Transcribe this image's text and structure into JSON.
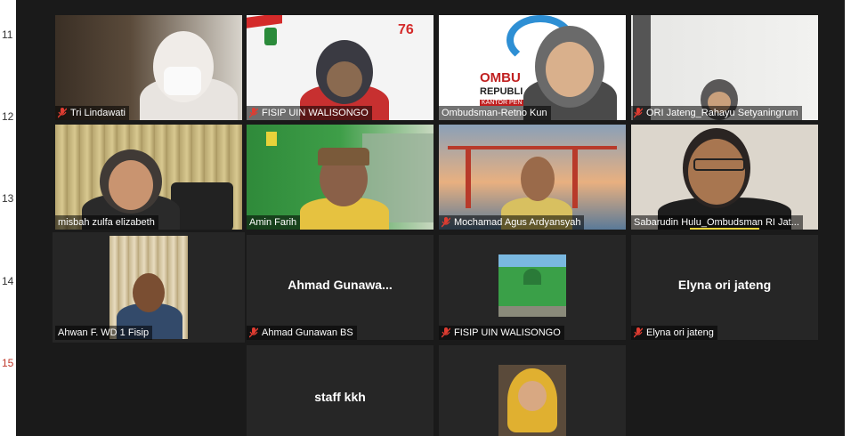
{
  "left_rail": {
    "numbers": [
      "11",
      "12",
      "13",
      "14",
      "15"
    ]
  },
  "participants": [
    {
      "name": "Tri Lindawati",
      "muted": true
    },
    {
      "name": "FISIP UIN WALISONGO",
      "muted": true
    },
    {
      "name": "Ombudsman-Retno Kun",
      "muted": false
    },
    {
      "name": "ORI Jateng_Rahayu Setyaningrum",
      "muted": true
    },
    {
      "name": "misbah zulfa elizabeth",
      "muted": false
    },
    {
      "name": "Amin Farih",
      "muted": false
    },
    {
      "name": "Mochamad Agus Ardyansyah",
      "muted": true
    },
    {
      "name": "Sabarudin Hulu_Ombudsman RI Jat...",
      "muted": false
    },
    {
      "name": "Ahwan F. WD 1 Fisip",
      "muted": false,
      "active_speaker": true
    },
    {
      "name": "Ahmad Gunawan BS",
      "muted": true,
      "display_label": "Ahmad  Gunawa..."
    },
    {
      "name": "FISIP UIN WALISONGO",
      "muted": true
    },
    {
      "name": "Elyna ori jateng",
      "muted": true,
      "display_label": "Elyna ori jateng"
    },
    {
      "name": "",
      "display_label": "staff kkh"
    },
    {
      "name": ""
    }
  ],
  "tile_texts": {
    "banner_76": "76",
    "ombudsman_logo": "OMBU",
    "republik": "REPUBLI",
    "kantor": "KANTOR PEN"
  },
  "colors": {
    "background": "#1a1a1a",
    "tile": "#262626",
    "active_outline": "#e6e69a",
    "mute_red": "#e03c31"
  }
}
